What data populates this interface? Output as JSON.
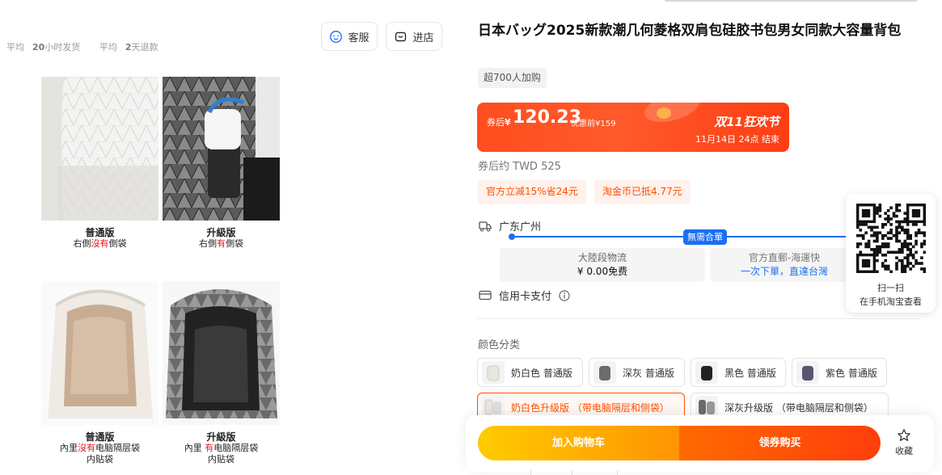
{
  "shipping": {
    "ship_prefix": "平均",
    "ship_value": "20",
    "ship_suffix": "小时发货",
    "refund_prefix": "平均",
    "refund_value": "2",
    "refund_suffix": "天退款"
  },
  "actions": {
    "service_label": "客服",
    "store_label": "进店"
  },
  "gallery": [
    {
      "title": "普通版",
      "line1_a": "右側",
      "line1_red": "沒有",
      "line1_b": "側袋",
      "line2": ""
    },
    {
      "title": "升級版",
      "line1_a": "右側",
      "line1_red": "有",
      "line1_b": "側袋",
      "line2": ""
    },
    {
      "title": "普通版",
      "line1_a": "內里",
      "line1_red": "沒有",
      "line1_b": "电脑隔层袋",
      "line2": "内贴袋"
    },
    {
      "title": "升級版",
      "line1_a": "內里 ",
      "line1_red": "有",
      "line1_b": "电脑隔层袋",
      "line2": "内贴袋"
    }
  ],
  "product": {
    "title": "日本バッグ2025新款潮几何菱格双肩包硅胶书包男女同款大容量背包",
    "buyers": "超700人加购"
  },
  "price": {
    "after_label": "券后",
    "currency": "¥",
    "amount": "120.23",
    "before_label": "优惠前¥159",
    "festival": "双11狂欢节",
    "ends": "11月14日 24点  结束"
  },
  "twd_text": "券后约 TWD 525",
  "promos": [
    "官方立减15%省24元",
    "淘金币已抵4.77元"
  ],
  "delivery": {
    "location": "广东广州",
    "badge": "無需合單",
    "option1_name": "大陸段物流",
    "option1_value": "¥ 0.00免费",
    "option2_name": "官方直郵-海運快",
    "option2_value": "一次下單，直達台灣"
  },
  "payment": {
    "label": "信用卡支付"
  },
  "color": {
    "title": "颜色分类",
    "options": [
      {
        "label": "奶白色 普通版",
        "selected": false
      },
      {
        "label": "深灰 普通版",
        "selected": false
      },
      {
        "label": "黑色 普通版",
        "selected": false
      },
      {
        "label": "紫色 普通版",
        "selected": false
      },
      {
        "label": "奶白色升级版 （带电脑隔层和侧袋）",
        "selected": true
      },
      {
        "label": "深灰升级版 （带电脑隔层和侧袋）",
        "selected": false
      }
    ]
  },
  "qr": {
    "line1": "扫一扫",
    "line2": "在手机淘宝查看"
  },
  "bottom": {
    "cart_label": "加入购物车",
    "buy_label": "领券购买",
    "fav_label": "收藏"
  },
  "colors": {
    "accent": "#ff5000",
    "blue": "#1d6ff2",
    "red_text": "#e4161c"
  }
}
